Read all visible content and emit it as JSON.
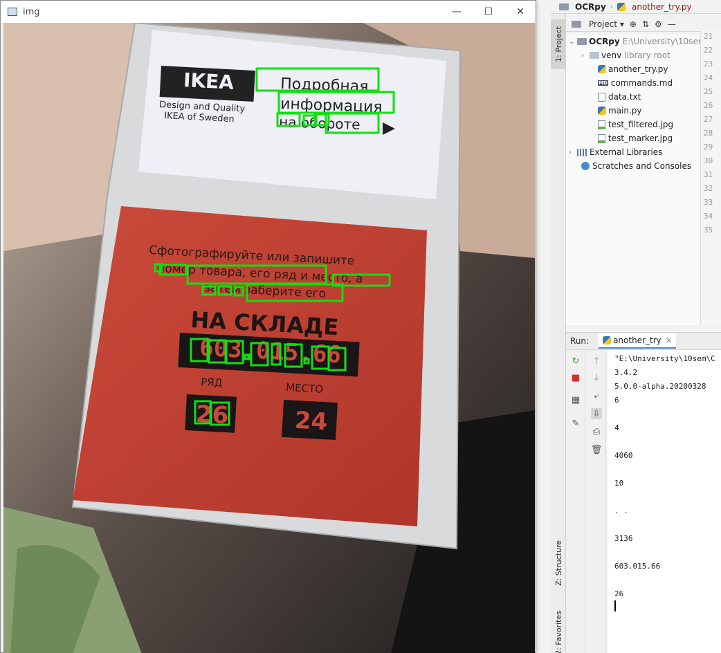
{
  "image_window": {
    "title": "img",
    "buttons": {
      "minimize": "—",
      "maximize": "☐",
      "close": "✕"
    }
  },
  "photo": {
    "ikea_logo": "IKEA",
    "ikea_tagline_1": "Design and Quality",
    "ikea_tagline_2": "IKEA of Sweden",
    "info_line_1": "Подробная",
    "info_line_2": "информация",
    "info_line_3": "на обороте",
    "instr_line_1": "Сфотографируйте или запишите",
    "instr_line_2": "номер товара, его ряд и место, а",
    "instr_line_3": "затем заберите его",
    "warehouse_title": "НА СКЛАДЕ",
    "article_number": "603.015.66",
    "row_label": "РЯД",
    "place_label": "МЕСТО",
    "row_value": "26",
    "place_value": "24"
  },
  "nav_bar": {
    "project": "OCRpy",
    "file": "another_try.py",
    "tab_peek": "r"
  },
  "side_stripe": {
    "project_tab": "1: Project",
    "structure_tab": "Z: Structure",
    "favorites_tab": "2: Favorites"
  },
  "project_panel": {
    "dropdown_label": "Project",
    "root": {
      "name": "OCRpy",
      "path": "E:\\University\\10sem\\"
    },
    "items": [
      {
        "name": "venv",
        "note": "library root",
        "kind": "folder"
      },
      {
        "name": "another_try.py",
        "kind": "py"
      },
      {
        "name": "commands.md",
        "kind": "md"
      },
      {
        "name": "data.txt",
        "kind": "txt"
      },
      {
        "name": "main.py",
        "kind": "py"
      },
      {
        "name": "test_filtered.jpg",
        "kind": "img"
      },
      {
        "name": "test_marker.jpg",
        "kind": "img"
      }
    ],
    "external_libraries": "External Libraries",
    "scratches": "Scratches and Consoles"
  },
  "line_numbers": [
    "21",
    "22",
    "23",
    "24",
    "25",
    "26",
    "27",
    "28",
    "29",
    "30",
    "31",
    "32",
    "33",
    "34",
    "35"
  ],
  "run_panel": {
    "label": "Run:",
    "tab": "another_try",
    "output": [
      "\"E:\\University\\10sem\\C",
      "3.4.2",
      "5.0.0-alpha.20200328",
      "6",
      "4",
      "4060",
      "10",
      ". .",
      "3136",
      "603.015.66",
      "26"
    ]
  }
}
